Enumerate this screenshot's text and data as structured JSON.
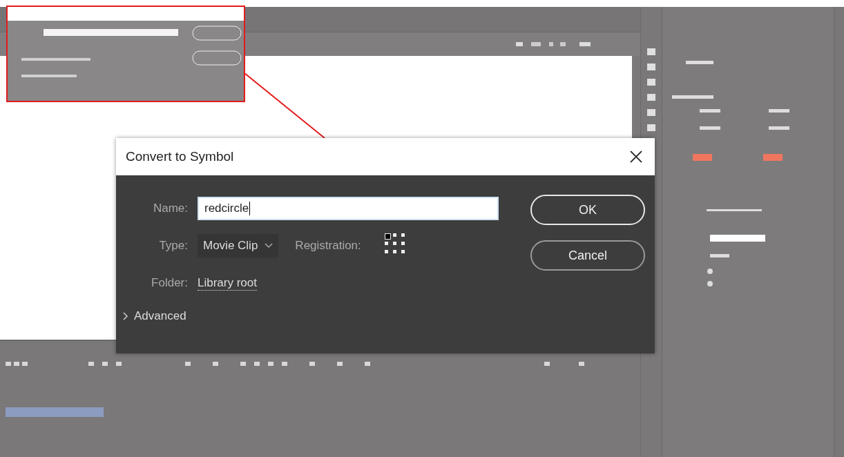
{
  "dialog": {
    "title": "Convert to Symbol",
    "name_label": "Name:",
    "name_value": "redcircle",
    "type_label": "Type:",
    "type_value": "Movie Clip",
    "registration_label": "Registration:",
    "registration_grid": [
      {
        "selected": true
      },
      {
        "selected": false
      },
      {
        "selected": false
      },
      {
        "selected": false
      },
      {
        "selected": false
      },
      {
        "selected": false
      },
      {
        "selected": false
      },
      {
        "selected": false
      },
      {
        "selected": false
      }
    ],
    "folder_label": "Folder:",
    "folder_value": "Library root",
    "advanced_label": "Advanced",
    "buttons": [
      "OK",
      "Cancel"
    ]
  },
  "timeline": {
    "layers": [
      {
        "selected": true
      }
    ]
  }
}
